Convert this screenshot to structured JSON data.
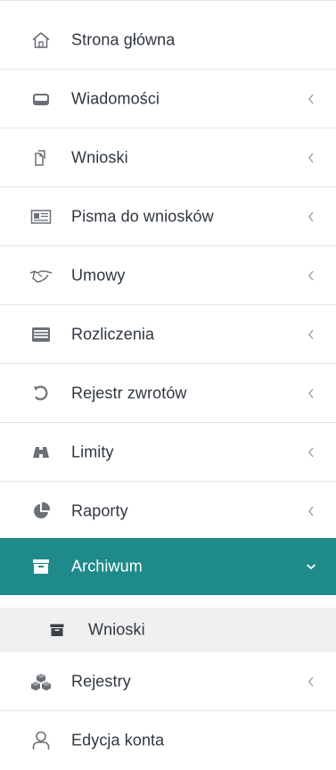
{
  "menu": {
    "items": [
      {
        "label": "Strona główna",
        "icon": "home-icon",
        "has_chevron": false
      },
      {
        "label": "Wiadomości",
        "icon": "inbox-icon",
        "has_chevron": true
      },
      {
        "label": "Wnioski",
        "icon": "documents-copy-icon",
        "has_chevron": true
      },
      {
        "label": "Pisma do wniosków",
        "icon": "newspaper-icon",
        "has_chevron": true
      },
      {
        "label": "Umowy",
        "icon": "handshake-icon",
        "has_chevron": true
      },
      {
        "label": "Rozliczenia",
        "icon": "list-card-icon",
        "has_chevron": true
      },
      {
        "label": "Rejestr zwrotów",
        "icon": "undo-icon",
        "has_chevron": true
      },
      {
        "label": "Limity",
        "icon": "binoculars-icon",
        "has_chevron": true
      },
      {
        "label": "Raporty",
        "icon": "pie-chart-icon",
        "has_chevron": true
      },
      {
        "label": "Archiwum",
        "icon": "archive-box-icon",
        "has_chevron": true,
        "active": true,
        "expanded": true
      },
      {
        "label": "Wnioski",
        "icon": "archive-box-icon",
        "has_chevron": false,
        "sub": true
      },
      {
        "label": "Rejestry",
        "icon": "cubes-icon",
        "has_chevron": true
      },
      {
        "label": "Edycja konta",
        "icon": "user-icon",
        "has_chevron": false
      }
    ]
  },
  "colors": {
    "active_bg": "#1f8a8a",
    "active_text": "#ffffff",
    "sub_bg": "#f0f0f0",
    "text": "#2f3640",
    "icon": "#6b7076",
    "chevron": "#9a9ea3",
    "divider": "#e6e6e6"
  }
}
